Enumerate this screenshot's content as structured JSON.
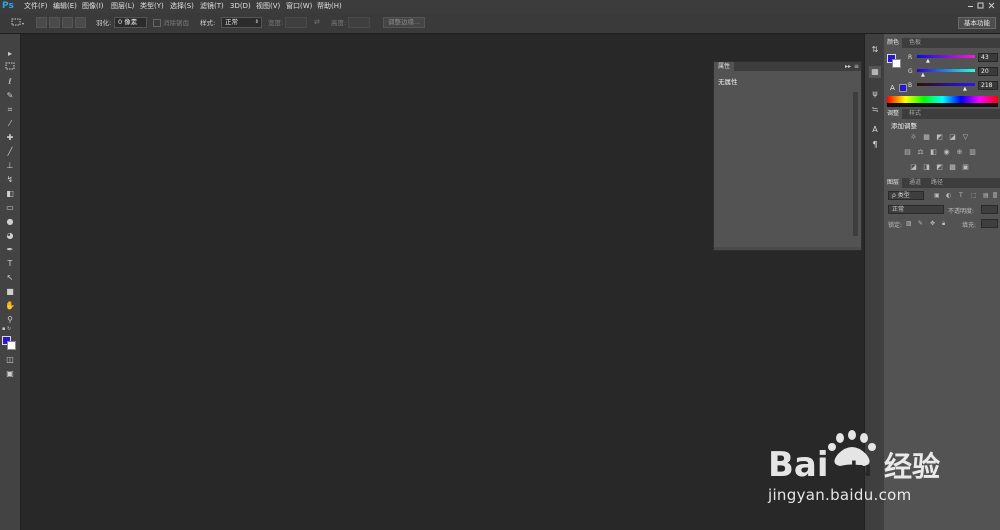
{
  "app": {
    "logo": "Ps"
  },
  "menu": {
    "items": [
      "文件(F)",
      "编辑(E)",
      "图像(I)",
      "图层(L)",
      "类型(Y)",
      "选择(S)",
      "滤镜(T)",
      "3D(D)",
      "视图(V)",
      "窗口(W)",
      "帮助(H)"
    ]
  },
  "options": {
    "feather_label": "羽化:",
    "feather_value": "0 像素",
    "antialias_label": "消除锯齿",
    "style_label": "样式:",
    "style_value": "正常",
    "width_label": "宽度:",
    "height_label": "高度:",
    "refine_edge": "调整边缘...",
    "workspace": "基本功能"
  },
  "properties_panel": {
    "tab": "属性",
    "collapse": "▸▸",
    "menu": "≡",
    "content": "无属性"
  },
  "color_panel": {
    "tabs": [
      "颜色",
      "色板"
    ],
    "channels": [
      {
        "label": "R",
        "value": "43"
      },
      {
        "label": "G",
        "value": "20"
      },
      {
        "label": "B",
        "value": "218"
      }
    ],
    "foreground": "#2b14da",
    "background": "#ffffff"
  },
  "adjust_panel": {
    "tabs": [
      "调整",
      "样式"
    ],
    "title": "添加调整"
  },
  "layers_panel": {
    "tabs": [
      "图层",
      "通道",
      "路径"
    ],
    "filter_label": "ρ 类型",
    "blend_mode": "正常",
    "opacity_label": "不透明度:",
    "lock_label": "锁定:",
    "fill_label": "填充:"
  },
  "watermark": {
    "brand": "Baidu经验",
    "url": "jingyan.baidu.com"
  }
}
